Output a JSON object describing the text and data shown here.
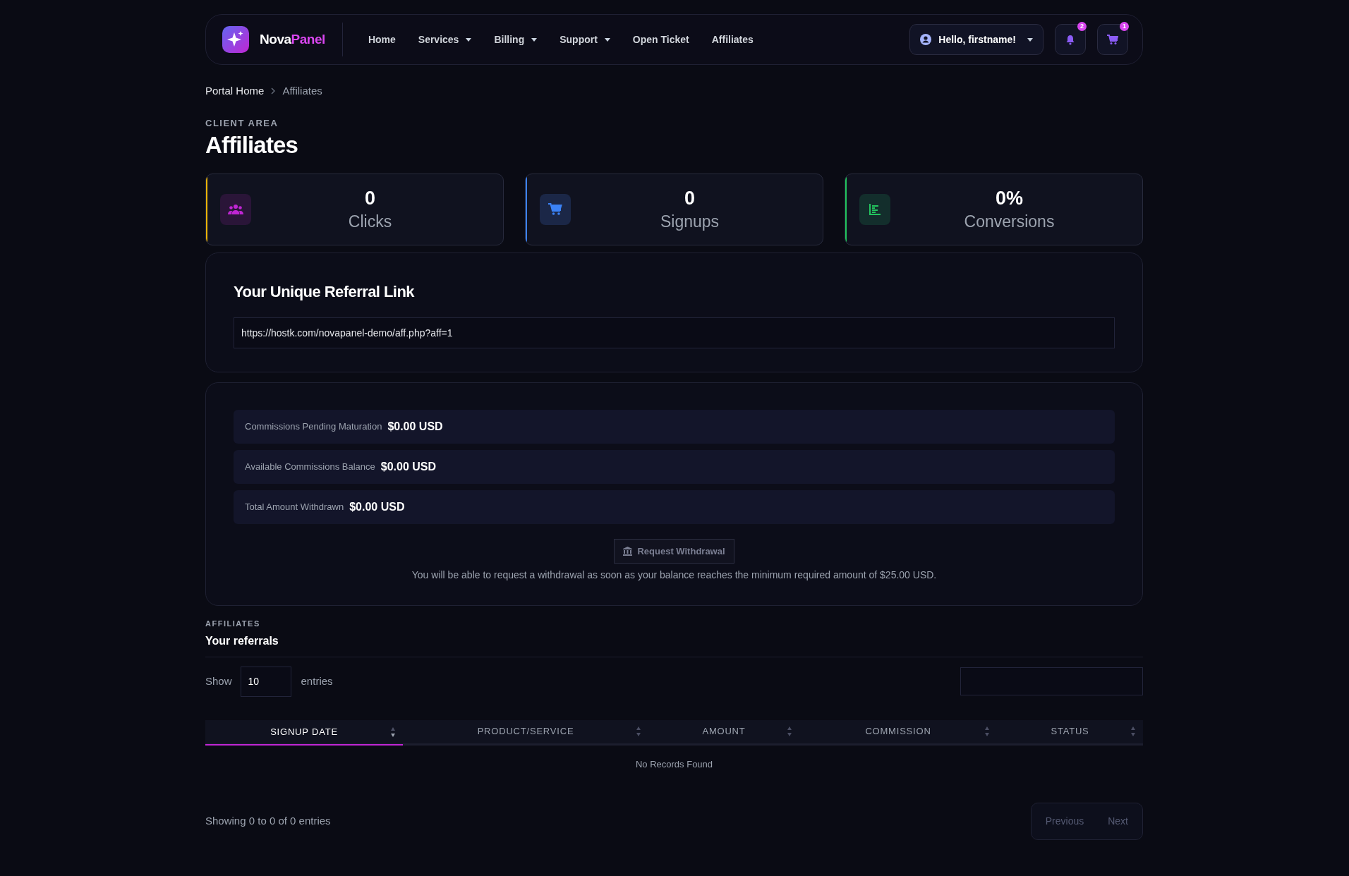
{
  "header": {
    "brand": {
      "part1": "Nova",
      "part2": "Panel"
    },
    "nav": [
      {
        "label": "Home",
        "dropdown": false
      },
      {
        "label": "Services",
        "dropdown": true
      },
      {
        "label": "Billing",
        "dropdown": true
      },
      {
        "label": "Support",
        "dropdown": true
      },
      {
        "label": "Open Ticket",
        "dropdown": false
      },
      {
        "label": "Affiliates",
        "dropdown": false
      }
    ],
    "user_menu": "Hello, firstname!",
    "notifications_count": "2",
    "cart_count": "1"
  },
  "breadcrumb": [
    {
      "label": "Portal Home",
      "selected": false
    },
    {
      "label": "Affiliates",
      "selected": true
    }
  ],
  "page": {
    "eyebrow": "CLIENT AREA",
    "title": "Affiliates"
  },
  "stats": [
    {
      "kind": "clicks",
      "value": "0",
      "label": "Clicks",
      "color": "#eab308"
    },
    {
      "kind": "signups",
      "value": "0",
      "label": "Signups",
      "color": "#3b82f6"
    },
    {
      "kind": "conversions",
      "value": "0%",
      "label": "Conversions",
      "color": "#22c55e"
    }
  ],
  "referral": {
    "title": "Your Unique Referral Link",
    "link": "https://hostk.com/novapanel-demo/aff.php?aff=1"
  },
  "commissions": [
    {
      "label": "Commissions Pending Maturation",
      "value": "$0.00 USD"
    },
    {
      "label": "Available Commissions Balance",
      "value": "$0.00 USD"
    },
    {
      "label": "Total Amount Withdrawn",
      "value": "$0.00 USD"
    }
  ],
  "withdrawal": {
    "button": "Request Withdrawal",
    "disabled": true,
    "note": "You will be able to request a withdrawal as soon as your balance reaches the minimum required amount of $25.00 USD."
  },
  "referrals": {
    "eyebrow": "AFFILIATES",
    "title": "Your referrals",
    "show_label": "Show",
    "entries_value": "10",
    "entries_label": "entries",
    "columns": [
      {
        "label": "SIGNUP DATE",
        "selected": true
      },
      {
        "label": "PRODUCT/SERVICE",
        "selected": false
      },
      {
        "label": "AMOUNT",
        "selected": false
      },
      {
        "label": "COMMISSION",
        "selected": false
      },
      {
        "label": "STATUS",
        "selected": false
      }
    ],
    "empty": "No Records Found",
    "info": "Showing 0 to 0 of 0 entries",
    "pagination": [
      {
        "label": "Previous",
        "disabled": true
      },
      {
        "label": "Next",
        "disabled": true
      }
    ]
  }
}
